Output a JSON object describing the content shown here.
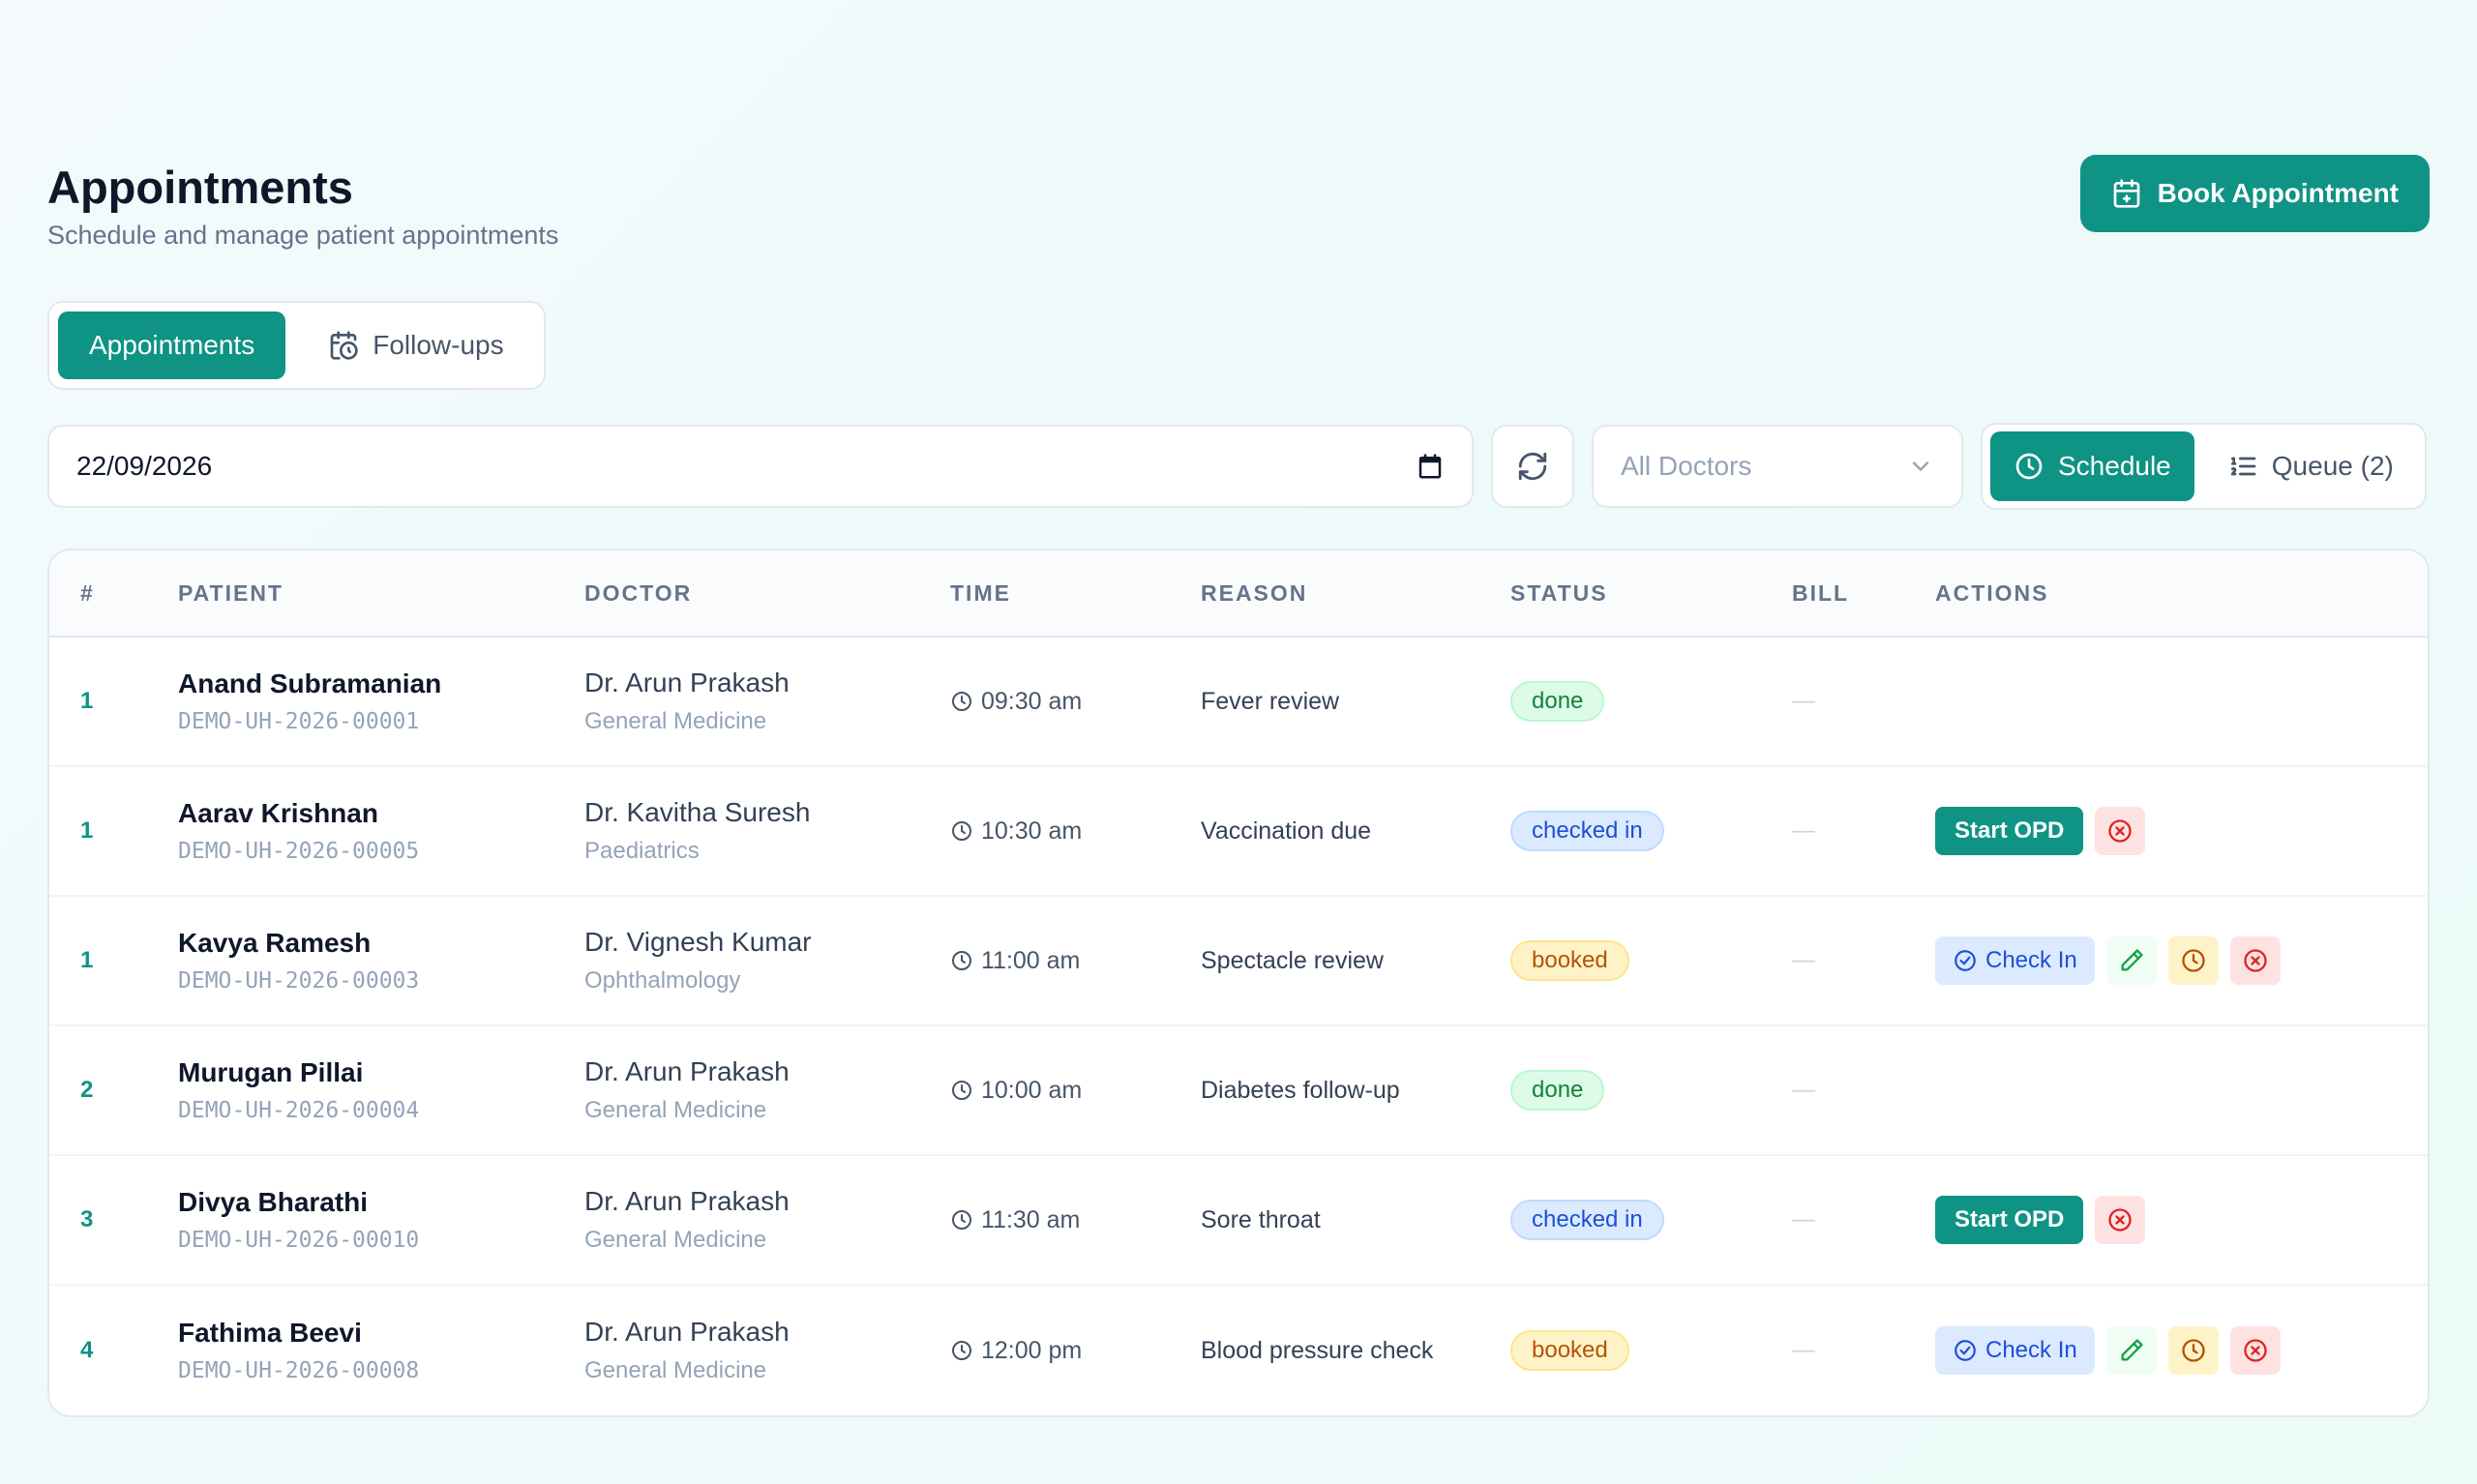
{
  "header": {
    "title": "Appointments",
    "subtitle": "Schedule and manage patient appointments",
    "book_button": "Book Appointment"
  },
  "tabs": [
    {
      "label": "Appointments",
      "active": true
    },
    {
      "label": "Follow-ups",
      "active": false
    }
  ],
  "filters": {
    "date": "22/09/2026",
    "doctor_placeholder": "All Doctors",
    "views": [
      {
        "label": "Schedule",
        "active": true
      },
      {
        "label": "Queue (2)",
        "active": false
      }
    ]
  },
  "table": {
    "columns": [
      "#",
      "PATIENT",
      "DOCTOR",
      "TIME",
      "REASON",
      "STATUS",
      "BILL",
      "ACTIONS"
    ],
    "rows": [
      {
        "idx": "1",
        "patient": "Anand Subramanian",
        "patient_id": "DEMO-UH-2026-00001",
        "doctor": "Dr. Arun Prakash",
        "dept": "General Medicine",
        "time": "09:30 am",
        "reason": "Fever review",
        "status": "done",
        "bill": "—"
      },
      {
        "idx": "1",
        "patient": "Aarav Krishnan",
        "patient_id": "DEMO-UH-2026-00005",
        "doctor": "Dr. Kavitha Suresh",
        "dept": "Paediatrics",
        "time": "10:30 am",
        "reason": "Vaccination due",
        "status": "checked in",
        "bill": "—",
        "action_label": "Start OPD"
      },
      {
        "idx": "1",
        "patient": "Kavya Ramesh",
        "patient_id": "DEMO-UH-2026-00003",
        "doctor": "Dr. Vignesh Kumar",
        "dept": "Ophthalmology",
        "time": "11:00 am",
        "reason": "Spectacle review",
        "status": "booked",
        "bill": "—",
        "action_label": "Check In"
      },
      {
        "idx": "2",
        "patient": "Murugan Pillai",
        "patient_id": "DEMO-UH-2026-00004",
        "doctor": "Dr. Arun Prakash",
        "dept": "General Medicine",
        "time": "10:00 am",
        "reason": "Diabetes follow-up",
        "status": "done",
        "bill": "—"
      },
      {
        "idx": "3",
        "patient": "Divya Bharathi",
        "patient_id": "DEMO-UH-2026-00010",
        "doctor": "Dr. Arun Prakash",
        "dept": "General Medicine",
        "time": "11:30 am",
        "reason": "Sore throat",
        "status": "checked in",
        "bill": "—",
        "action_label": "Start OPD"
      },
      {
        "idx": "4",
        "patient": "Fathima Beevi",
        "patient_id": "DEMO-UH-2026-00008",
        "doctor": "Dr. Arun Prakash",
        "dept": "General Medicine",
        "time": "12:00 pm",
        "reason": "Blood pressure check",
        "status": "booked",
        "bill": "—",
        "action_label": "Check In"
      }
    ]
  },
  "colors": {
    "accent": "#0e9384",
    "done": "#15803d",
    "checked_in": "#1d4ed8",
    "booked": "#b45309",
    "danger": "#dc2626"
  }
}
